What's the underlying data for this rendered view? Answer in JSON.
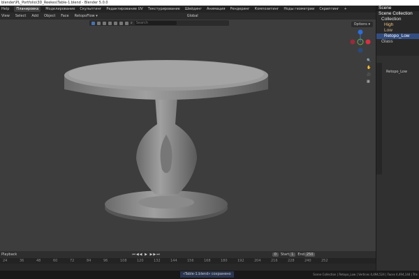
{
  "window": {
    "title": "blender\\PL_Portfolio\\3D_Reekes\\Table-1.blend - Blender 5.0.0"
  },
  "menu": {
    "items": [
      "Help",
      "Планировка",
      "Моделирование",
      "Скульптинг",
      "Редактирование UV",
      "Текстурирование",
      "Шейдинг",
      "Анимация",
      "Рендеринг",
      "Композитинг",
      "Ноды геометрии",
      "Скриптинг",
      "+"
    ],
    "active_index": 1
  },
  "header": {
    "items": [
      "View",
      "Select",
      "Add",
      "Object",
      "Face",
      "RetopoFlow ▾"
    ],
    "orientation": "Global",
    "search_placeholder": "Search",
    "options": "Options ▾"
  },
  "outliner": {
    "scene": "Scene",
    "rows": [
      "Scene Collection",
      "Collection",
      "High",
      "Low",
      "Retopo_Low",
      "Glass"
    ],
    "selected_index": 4
  },
  "properties": {
    "object_name": "Retopo_Low"
  },
  "timeline": {
    "mode": "Playback",
    "current_frame": "0",
    "start_label": "Start",
    "start": "1",
    "end_label": "End",
    "end": "250",
    "ticks": [
      "24",
      "36",
      "48",
      "60",
      "72",
      "84",
      "96",
      "108",
      "120",
      "132",
      "144",
      "156",
      "168",
      "180",
      "192",
      "204",
      "216",
      "228",
      "240",
      "252"
    ]
  },
  "status": {
    "message": "«Table-1.blend» сохранено",
    "stats": "Scene Collection | Retopo_Low | Vertices 4,494,524 | Faces 4,494,144 | Tris"
  },
  "colors": {
    "accent": "#4772b3",
    "viewport_bg": "#3d3d3d",
    "model": "#8a8a8a"
  }
}
